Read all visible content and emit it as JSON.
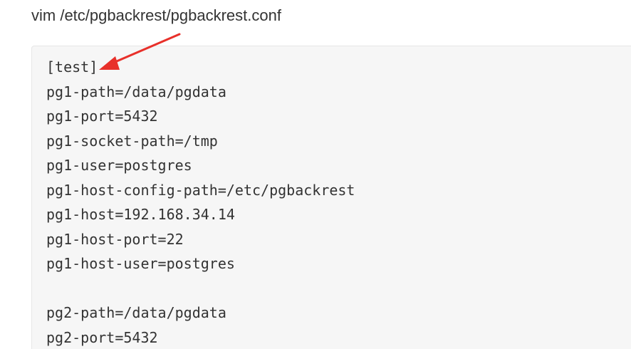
{
  "command": "vim /etc/pgbackrest/pgbackrest.conf",
  "config_lines": [
    "[test]",
    "pg1-path=/data/pgdata",
    "pg1-port=5432",
    "pg1-socket-path=/tmp",
    "pg1-user=postgres",
    "pg1-host-config-path=/etc/pgbackrest",
    "pg1-host=192.168.34.14",
    "pg1-host-port=22",
    "pg1-host-user=postgres",
    "",
    "pg2-path=/data/pgdata",
    "pg2-port=5432"
  ],
  "annotation": {
    "icon": "red-arrow-icon",
    "color": "#e8302a"
  }
}
